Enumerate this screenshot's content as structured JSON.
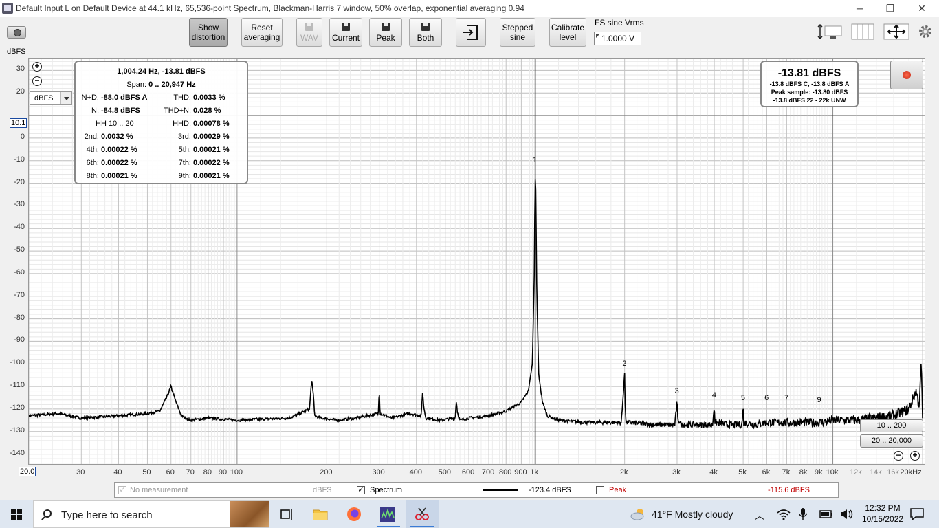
{
  "window": {
    "title": "Default Input L on Default Device at 44.1 kHz, 65,536-point Spectrum, Blackman-Harris 7 window, 50% overlap, exponential averaging 0.94",
    "controls": {
      "minimize": "─",
      "restore": "❐",
      "close": "✕"
    }
  },
  "toolbar": {
    "show_distortion": "Show\ndistortion",
    "reset_averaging": "Reset\naveraging",
    "wav": "WAV",
    "current": "Current",
    "peak": "Peak",
    "both": "Both",
    "stepped_sine": "Stepped\nsine",
    "calibrate_level": "Calibrate\nlevel",
    "fs_label": "FS sine Vrms",
    "fs_value": "1.0000 V"
  },
  "graph": {
    "y_unit": "dBFS",
    "unit_select": "dBFS",
    "y_ticks": [
      "30",
      "20",
      "0",
      "-10",
      "-20",
      "-30",
      "-40",
      "-50",
      "-60",
      "-70",
      "-80",
      "-90",
      "-100",
      "-110",
      "-120",
      "-130",
      "-140"
    ],
    "y_marker": "10.1",
    "x_min_box": "20.0",
    "x_ticks": [
      "30",
      "40",
      "50",
      "60",
      "70",
      "80",
      "90",
      "100",
      "200",
      "300",
      "400",
      "500",
      "600",
      "700",
      "800",
      "900",
      "1k",
      "2k",
      "3k",
      "4k",
      "5k",
      "6k",
      "7k",
      "8k",
      "9k",
      "10k",
      "12k",
      "14k",
      "16k",
      "20kHz"
    ],
    "x_ticks_minor": [
      "12k",
      "14k",
      "16k"
    ],
    "harmonic_labels": [
      "1",
      "2",
      "3",
      "4",
      "5",
      "6",
      "7",
      "9"
    ],
    "range_buttons": [
      "10 .. 200",
      "20 .. 20,000"
    ]
  },
  "distortion": {
    "header": "1,004.24 Hz, -13.81 dBFS",
    "span_label": "Span:",
    "span_value": "0 .. 20,947 Hz",
    "rows": [
      {
        "l1": "N+D:",
        "v1": "-88.0 dBFS A",
        "l2": "THD:",
        "v2": "0.0033 %"
      },
      {
        "l1": "N:",
        "v1": "-84.8 dBFS",
        "l2": "THD+N:",
        "v2": "0.028 %"
      },
      {
        "l1": "",
        "v1": "HH 10 .. 20",
        "l2": "HHD:",
        "v2": "0.00078 %"
      },
      {
        "l1": "2nd:",
        "v1": "0.0032 %",
        "l2": "3rd:",
        "v2": "0.00029 %"
      },
      {
        "l1": "4th:",
        "v1": "0.00022 %",
        "l2": "5th:",
        "v2": "0.00021 %"
      },
      {
        "l1": "6th:",
        "v1": "0.00022 %",
        "l2": "7th:",
        "v2": "0.00022 %"
      },
      {
        "l1": "8th:",
        "v1": "0.00021 %",
        "l2": "9th:",
        "v2": "0.00021 %"
      }
    ]
  },
  "level": {
    "main": "-13.81 dBFS",
    "line1": "-13.8 dBFS C, -13.8 dBFS A",
    "line2": "Peak sample: -13.80 dBFS",
    "line3": "-13.8 dBFS 22 - 22k UNW"
  },
  "legend": {
    "no_measurement": "No measurement",
    "no_measurement_unit": "dBFS",
    "spectrum": "Spectrum",
    "spectrum_value": "-123.4 dBFS",
    "peak": "Peak",
    "peak_value": "-115.6 dBFS",
    "peak_color": "#c00000"
  },
  "taskbar": {
    "search_placeholder": "Type here to search",
    "weather": "41°F  Mostly cloudy",
    "time": "12:32 PM",
    "date": "10/15/2022"
  },
  "chart_data": {
    "type": "line",
    "x_scale": "log",
    "xlim": [
      20,
      20000
    ],
    "ylim": [
      -145,
      35
    ],
    "series": [
      {
        "name": "Spectrum",
        "x": [
          20,
          25,
          30,
          40,
          50,
          55,
          58,
          60,
          62,
          65,
          70,
          80,
          100,
          150,
          175,
          178,
          180,
          182,
          190,
          220,
          250,
          298,
          300,
          302,
          330,
          380,
          415,
          418,
          420,
          422,
          430,
          480,
          540,
          542,
          545,
          548,
          560,
          600,
          700,
          800,
          900,
          950,
          980,
          995,
          1000,
          1004,
          1008,
          1015,
          1030,
          1060,
          1100,
          1200,
          1500,
          1950,
          2000,
          2008,
          2020,
          2100,
          2500,
          2950,
          3000,
          3010,
          3100,
          3500,
          3950,
          4000,
          4020,
          4500,
          4950,
          5000,
          5020,
          5500,
          6000,
          7000,
          8000,
          9000,
          10000,
          12000,
          14000,
          16000,
          18000,
          19000,
          19500,
          19800,
          20000
        ],
        "y": [
          -123,
          -122,
          -124,
          -123,
          -122,
          -121,
          -115,
          -110,
          -116,
          -123,
          -125,
          -124,
          -125,
          -124,
          -120,
          -107,
          -112,
          -123,
          -124,
          -125,
          -124,
          -122,
          -111,
          -122,
          -124,
          -122,
          -123,
          -116,
          -111,
          -118,
          -124,
          -125,
          -124,
          -120,
          -116,
          -121,
          -125,
          -124,
          -123,
          -121,
          -117,
          -112,
          -100,
          -60,
          -25,
          -13.8,
          -30,
          -70,
          -105,
          -117,
          -123,
          -125,
          -126,
          -126,
          -104,
          -118,
          -126,
          -126,
          -127,
          -127,
          -116,
          -124,
          -127,
          -127,
          -127,
          -118,
          -126,
          -127,
          -127,
          -119,
          -126,
          -127,
          -126,
          -126,
          -126,
          -126,
          -125,
          -125,
          -124,
          -123,
          -120,
          -112,
          -118,
          -98,
          -125
        ]
      }
    ],
    "ylabel": "dBFS",
    "xlabel": "",
    "harmonics": [
      {
        "label": "1",
        "freq": 1004,
        "level": -13.8
      },
      {
        "label": "2",
        "freq": 2008,
        "level": -104
      },
      {
        "label": "3",
        "freq": 3012,
        "level": -116
      },
      {
        "label": "4",
        "freq": 4017,
        "level": -118
      },
      {
        "label": "5",
        "freq": 5021,
        "level": -119
      },
      {
        "label": "6",
        "freq": 6025,
        "level": -119
      },
      {
        "label": "7",
        "freq": 7030,
        "level": -119
      },
      {
        "label": "9",
        "freq": 9038,
        "level": -120
      }
    ],
    "cursor_level": 10.1
  }
}
